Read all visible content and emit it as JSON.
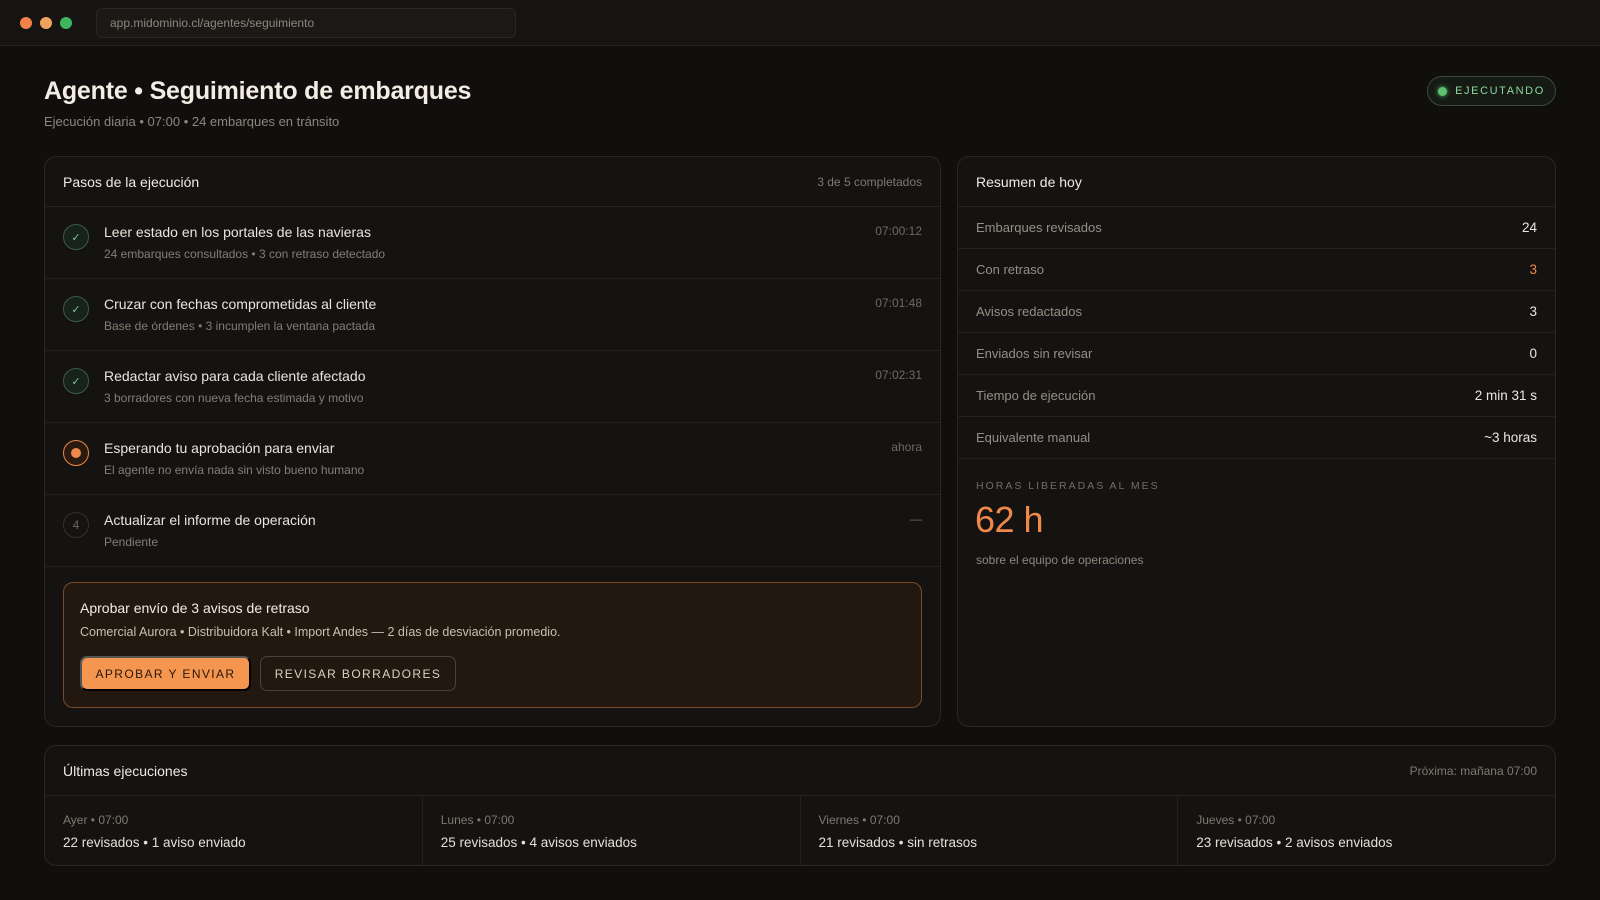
{
  "browser": {
    "url": "app.midominio.cl/agentes/seguimiento"
  },
  "header": {
    "title": "Agente • Seguimiento de embarques",
    "subtitle": "Ejecución diaria • 07:00 • 24 embarques en tránsito",
    "status": "EJECUTANDO"
  },
  "steps": {
    "title": "Pasos de la ejecución",
    "progress": "3 de 5 completados",
    "items": [
      {
        "state": "done",
        "icon": "check-icon",
        "marker": "✓",
        "title": "Leer estado en los portales de las navieras",
        "desc": "24 embarques consultados • 3 con retraso detectado",
        "time": "07:00:12"
      },
      {
        "state": "done",
        "icon": "check-icon",
        "marker": "✓",
        "title": "Cruzar con fechas comprometidas al cliente",
        "desc": "Base de órdenes • 3 incumplen la ventana pactada",
        "time": "07:01:48"
      },
      {
        "state": "done",
        "icon": "check-icon",
        "marker": "✓",
        "title": "Redactar aviso para cada cliente afectado",
        "desc": "3 borradores con nueva fecha estimada y motivo",
        "time": "07:02:31"
      },
      {
        "state": "active",
        "icon": "in-progress-dot-icon",
        "marker": "",
        "title": "Esperando tu aprobación para enviar",
        "desc": "El agente no envía nada sin visto bueno humano",
        "time": "ahora"
      },
      {
        "state": "pend",
        "icon": "step-number-icon",
        "marker": "4",
        "title": "Actualizar el informe de operación",
        "desc": "Pendiente",
        "time": "—"
      }
    ]
  },
  "approval": {
    "title": "Aprobar envío de 3 avisos de retraso",
    "desc": "Comercial Aurora • Distribuidora Kalt • Import Andes — 2 días de desviación promedio.",
    "approve_label": "APROBAR Y ENVIAR",
    "review_label": "REVISAR BORRADORES"
  },
  "summary": {
    "title": "Resumen de hoy",
    "rows": [
      {
        "label": "Embarques revisados",
        "value": "24"
      },
      {
        "label": "Con retraso",
        "value": "3",
        "highlight": true
      },
      {
        "label": "Avisos redactados",
        "value": "3"
      },
      {
        "label": "Enviados sin revisar",
        "value": "0"
      },
      {
        "label": "Tiempo de ejecución",
        "value": "2 min 31 s"
      },
      {
        "label": "Equivalente manual",
        "value": "~3 horas"
      }
    ],
    "hours_label": "HORAS LIBERADAS AL MES",
    "hours_value": "62 h",
    "hours_note": "sobre el equipo de operaciones"
  },
  "history": {
    "title": "Últimas ejecuciones",
    "next": "Próxima: mañana 07:00",
    "items": [
      {
        "when": "Ayer • 07:00",
        "what": "22 revisados • 1 aviso enviado"
      },
      {
        "when": "Lunes • 07:00",
        "what": "25 revisados • 4 avisos enviados"
      },
      {
        "when": "Viernes • 07:00",
        "what": "21 revisados • sin retrasos"
      },
      {
        "when": "Jueves • 07:00",
        "what": "23 revisados • 2 avisos enviados"
      }
    ]
  },
  "colors": {
    "accent": "#f4964f",
    "success": "#5ec26f",
    "background": "#110f0d",
    "card": "#151311"
  }
}
